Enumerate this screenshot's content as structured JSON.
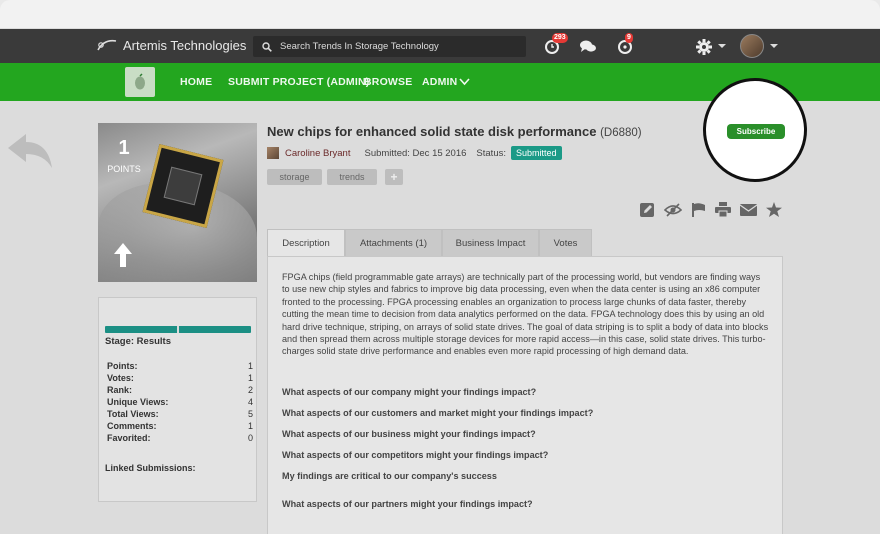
{
  "header": {
    "brand": "Artemis Technologies",
    "search_placeholder": "Search Trends In Storage Technology",
    "notif_badge_1": "293",
    "notif_badge_2": "9"
  },
  "nav": {
    "items": [
      "HOME",
      "SUBMIT PROJECT (ADMIN)",
      "BROWSE",
      "ADMIN"
    ]
  },
  "submission": {
    "points": "1",
    "points_label": "POINTS",
    "title": "New chips for enhanced solid state disk performance",
    "id": "(D6880)",
    "author": "Caroline Bryant",
    "submitted": "Submitted: Dec 15 2016",
    "status_label": "Status:",
    "status": "Submitted",
    "tags": [
      "storage",
      "trends"
    ],
    "tag_add": "+",
    "subscribe": "Subscribe"
  },
  "stats": {
    "stage": "Stage: Results",
    "rows": [
      {
        "label": "Points:",
        "value": "1"
      },
      {
        "label": "Votes:",
        "value": "1"
      },
      {
        "label": "Rank:",
        "value": "2"
      },
      {
        "label": "Unique Views:",
        "value": "4"
      },
      {
        "label": "Total Views:",
        "value": "5"
      },
      {
        "label": "Comments:",
        "value": "1"
      },
      {
        "label": "Favorited:",
        "value": "0"
      }
    ],
    "linked": "Linked Submissions:"
  },
  "tabs": [
    "Description",
    "Attachments (1)",
    "Business Impact",
    "Votes"
  ],
  "description": "FPGA chips (field programmable gate arrays) are technically part of the processing world, but vendors are finding ways to use new chip styles and fabrics to improve big data processing, even when the data center is using an x86 computer fronted to the processing. FPGA processing enables an organization to process large chunks of data faster, thereby cutting the mean time to decision from data analytics performed on the data. FPGA technology does this by using an old hard drive technique, striping, on arrays of solid state drives. The goal of data striping is to split a body of data into blocks and then spread them across multiple storage devices for more rapid access—in this case, solid state drives. This turbo-charges solid state drive performance and enables even more rapid processing of high demand data.",
  "questions": [
    "What aspects of our company might your findings impact?",
    "What aspects of our customers and market might your findings impact?",
    "What aspects of our business might your findings impact?",
    "What aspects of our competitors might your findings impact?",
    "My findings are critical to our company's success",
    "What aspects of our partners might your findings impact?"
  ],
  "colors": {
    "nav_green": "#23a61f",
    "status_teal": "#1b9a87",
    "subscribe_green": "#2a8f2a",
    "topbar": "#3a3a3a"
  },
  "icons": [
    "search-icon",
    "refresh-badge-icon",
    "chat-icon",
    "alert-badge-icon",
    "gear-icon",
    "edit-icon",
    "hide-icon",
    "flag-icon",
    "print-icon",
    "mail-icon",
    "star-icon",
    "back-arrow-icon",
    "upvote-arrow-icon"
  ]
}
